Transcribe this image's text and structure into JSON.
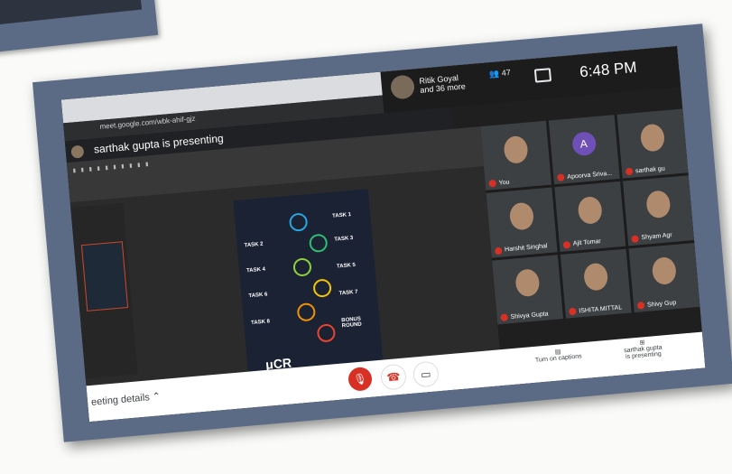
{
  "browser": {
    "url": "meet.google.com/wbk-ahif-gjz"
  },
  "meet": {
    "presenter_chip": "Ritik Goyal\nand 36 more",
    "participant_count": "47",
    "time": "6:48 PM",
    "presenting_header": "sarthak gupta is presenting",
    "meeting_details": "eeting details",
    "captions_label": "Turn on captions",
    "presenting_label": "sarthak gupta\nis presenting"
  },
  "slide": {
    "labels": [
      "TASK 1",
      "TASK 2",
      "TASK 3",
      "TASK 4",
      "TASK 5",
      "TASK 6",
      "TASK 7",
      "TASK 8",
      "BONUS ROUND"
    ],
    "logo": "μCR"
  },
  "participants": [
    {
      "name": "You",
      "avatar": "face"
    },
    {
      "name": "Apoorva Sriva...",
      "avatar": "letter",
      "letter": "A",
      "color": "#6f4fb8"
    },
    {
      "name": "sarthak gu",
      "avatar": "face"
    },
    {
      "name": "Harshit Singhal",
      "avatar": "face"
    },
    {
      "name": "Ajit Tomar",
      "avatar": "face"
    },
    {
      "name": "Shyam Agr",
      "avatar": "face"
    },
    {
      "name": "Shivya Gupta",
      "avatar": "face"
    },
    {
      "name": "ISHITA MITTAL",
      "avatar": "face"
    },
    {
      "name": "Shivy Gup",
      "avatar": "face"
    }
  ],
  "colors": {
    "frame": "#5b6b86",
    "mic_off": "#d93025",
    "avatar_purple": "#6f4fb8"
  }
}
